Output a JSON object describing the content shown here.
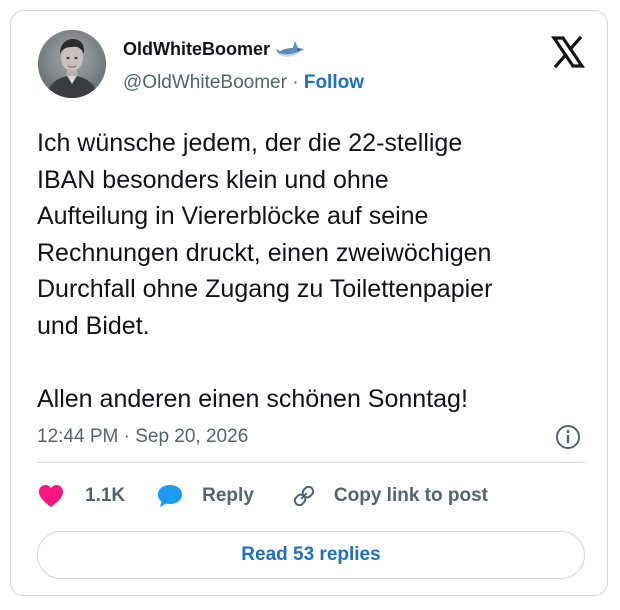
{
  "author": {
    "display_name": "OldWhiteBoomer",
    "handle": "@OldWhiteBoomer",
    "separator": " · ",
    "follow_label": "Follow",
    "name_emoji_icon": "shark-icon",
    "avatar": "avatar-portrait"
  },
  "brand_icon": "x-logo-icon",
  "tweet": {
    "text": "Ich wünsche jedem, der die 22-stellige\nIBAN besonders klein und ohne\nAufteilung in Viererblöcke auf seine\nRechnungen druckt, einen zweiwöchigen\nDurchfall ohne Zugang zu Toilettenpapier\nund Bidet.\n\nAllen anderen einen schönen Sonntag!",
    "timestamp": "12:44 PM · Sep 20, 2026",
    "info_icon": "info-icon"
  },
  "actions": {
    "like_count": "1.1K",
    "like_icon": "heart-icon",
    "reply_label": "Reply",
    "reply_icon": "speech-bubble-icon",
    "copy_label": "Copy link to post",
    "copy_icon": "link-icon"
  },
  "read_replies_label": "Read 53 replies",
  "colors": {
    "accent": "#1d6fc6",
    "heart": "#f91880",
    "reply_bubble": "#1d9bf0",
    "muted_text": "#536471",
    "border": "#cfd9de"
  }
}
